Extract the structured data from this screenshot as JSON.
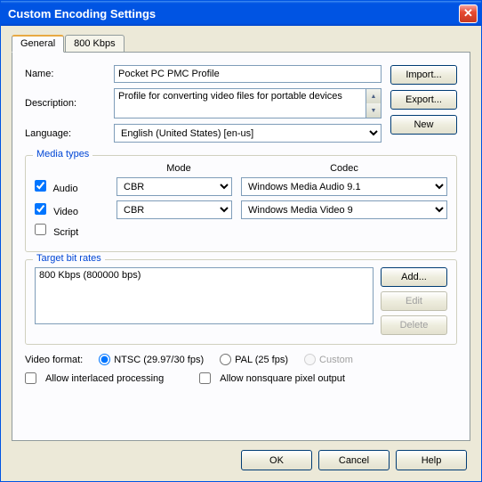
{
  "title": "Custom Encoding Settings",
  "tabs": {
    "general": "General",
    "kbps": "800 Kbps"
  },
  "labels": {
    "name": "Name:",
    "description": "Description:",
    "language": "Language:",
    "videoFormat": "Video format:"
  },
  "fields": {
    "name": "Pocket PC PMC Profile",
    "description": "Profile for converting video files for portable devices",
    "language": "English (United States) [en-us]"
  },
  "buttons": {
    "import": "Import...",
    "export": "Export...",
    "new": "New",
    "add": "Add...",
    "edit": "Edit",
    "delete": "Delete",
    "ok": "OK",
    "cancel": "Cancel",
    "help": "Help"
  },
  "mediaTypes": {
    "legend": "Media types",
    "headers": {
      "mode": "Mode",
      "codec": "Codec"
    },
    "audio": {
      "label": "Audio",
      "checked": true,
      "mode": "CBR",
      "codec": "Windows Media Audio 9.1"
    },
    "video": {
      "label": "Video",
      "checked": true,
      "mode": "CBR",
      "codec": "Windows Media Video 9"
    },
    "script": {
      "label": "Script",
      "checked": false
    }
  },
  "bitrates": {
    "legend": "Target bit rates",
    "items": [
      "800 Kbps (800000 bps)"
    ]
  },
  "videoFormat": {
    "ntsc": "NTSC (29.97/30 fps)",
    "pal": "PAL (25 fps)",
    "custom": "Custom",
    "selected": "ntsc"
  },
  "allow": {
    "interlaced": "Allow interlaced processing",
    "nonsquare": "Allow nonsquare pixel output"
  }
}
